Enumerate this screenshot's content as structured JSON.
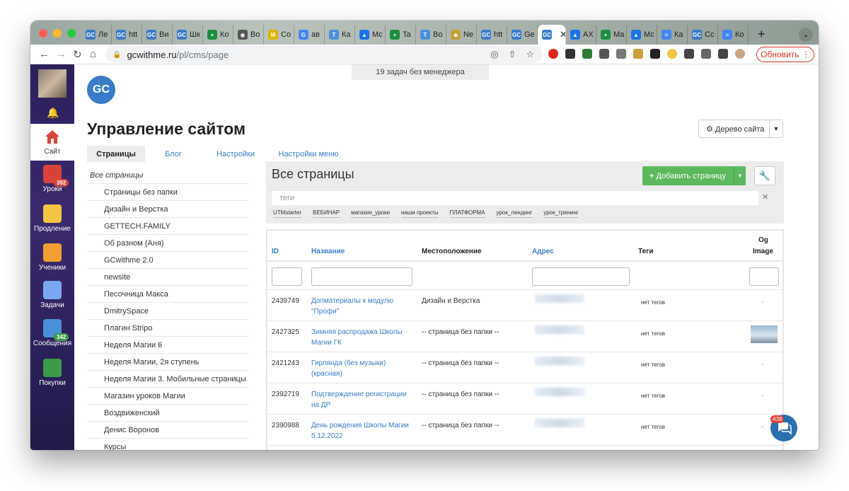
{
  "browser": {
    "tabs": [
      {
        "label": "Ле",
        "fav": "GC",
        "color": "#3a7bc8"
      },
      {
        "label": "htt",
        "fav": "GC",
        "color": "#3a7bc8"
      },
      {
        "label": "Ви",
        "fav": "GC",
        "color": "#3a7bc8"
      },
      {
        "label": "Шк",
        "fav": "GC",
        "color": "#3a7bc8"
      },
      {
        "label": "Ко",
        "fav": "+",
        "color": "#1e8e3e"
      },
      {
        "label": "Во",
        "fav": "◉",
        "color": "#555555"
      },
      {
        "label": "Со",
        "fav": "M",
        "color": "#e2b400"
      },
      {
        "label": "ав",
        "fav": "G",
        "color": "#4285f4"
      },
      {
        "label": "Ка",
        "fav": "T",
        "color": "#4a90d9"
      },
      {
        "label": "Мс",
        "fav": "▲",
        "color": "#1a73e8"
      },
      {
        "label": "Ta",
        "fav": "+",
        "color": "#1e8e3e"
      },
      {
        "label": "Во",
        "fav": "T",
        "color": "#4a90d9"
      },
      {
        "label": "Ne",
        "fav": "◆",
        "color": "#c8a03a"
      },
      {
        "label": "htt",
        "fav": "GC",
        "color": "#3a7bc8"
      },
      {
        "label": "Ge",
        "fav": "GC",
        "color": "#3a7bc8"
      },
      {
        "label": "",
        "fav": "GC",
        "color": "#3a7bc8",
        "active": true
      },
      {
        "label": "АХ",
        "fav": "▲",
        "color": "#1a73e8"
      },
      {
        "label": "Ма",
        "fav": "+",
        "color": "#1e8e3e"
      },
      {
        "label": "Мс",
        "fav": "▲",
        "color": "#1a73e8"
      },
      {
        "label": "Ка",
        "fav": "≡",
        "color": "#4285f4"
      },
      {
        "label": "Сс",
        "fav": "GC",
        "color": "#3a7bc8"
      },
      {
        "label": "Ко",
        "fav": "≡",
        "color": "#4285f4"
      }
    ],
    "url_domain": "gcwithme.ru",
    "url_path": "/pl/cms/page",
    "update_label": "Обновить"
  },
  "sidebar": {
    "site_label": "Сайт",
    "items": [
      {
        "label": "Уроки",
        "badge": "392",
        "badge_color": "#d9443a",
        "icon": "presentation-icon"
      },
      {
        "label": "Продление",
        "badge": "",
        "icon": "hourglass-icon"
      },
      {
        "label": "Ученики",
        "badge": "",
        "icon": "group-icon"
      },
      {
        "label": "Задачи",
        "badge": "",
        "icon": "checklist-icon"
      },
      {
        "label": "Сообщения",
        "badge": "342",
        "badge_color": "#3c9a4a",
        "icon": "chat-icon"
      },
      {
        "label": "Покупки",
        "badge": "",
        "icon": "calculator-icon"
      }
    ]
  },
  "header": {
    "notice": "19 задач без менеджера",
    "logo": "GC",
    "title": "Управление сайтом",
    "tree_button": "Дерево сайта"
  },
  "subtabs": [
    {
      "label": "Страницы",
      "active": true
    },
    {
      "label": "Блог"
    },
    {
      "label": "Настройки"
    },
    {
      "label": "Настройки меню"
    }
  ],
  "leftnav": [
    "Все страницы",
    "Страницы без папки",
    "Дизайн и Верстка",
    "GETTECH.FAMILY",
    "Об разном (Аня)",
    "GCwithme 2.0",
    "newsite",
    "Песочница Макса",
    "DmitrySpace",
    "Плагин Stripo",
    "Неделя Магии 6",
    "Неделя Магии, 2я ступень",
    "Неделя Магии 3. Мобильные страницы",
    "Магазин уроков Магии",
    "Воздвиженский",
    "Денис Воронов",
    "Курсы"
  ],
  "panel": {
    "title": "Все страницы",
    "add_button": "Добавить страницу",
    "tags_placeholder": "теги",
    "tags": [
      "UTMstarter",
      "ВЕБИНАР",
      "магазин_уроки",
      "наши проекты",
      "ПЛАТФОРМА",
      "урок_лендинг",
      "урок_тренинг"
    ]
  },
  "table": {
    "headers": {
      "id": "ID",
      "name": "Название",
      "location": "Местоположение",
      "address": "Адрес",
      "tags": "Теги",
      "og_line1": "Og",
      "og_line2": "Image"
    },
    "rows": [
      {
        "id": "2439749",
        "name": "Допматериалы к модулю \"Профи\"",
        "location": "Дизайн и Верстка",
        "tags": "нет тегов",
        "og": "-",
        "has_image": false
      },
      {
        "id": "2427325",
        "name": "Зимняя распродажа Школы Магии ГК",
        "location": "-- страница без папки --",
        "tags": "нет тегов",
        "og": "",
        "has_image": true
      },
      {
        "id": "2421243",
        "name": "Гирлянда (без музыки) (красная)",
        "location": "-- страница без папки --",
        "tags": "нет тегов",
        "og": "-",
        "has_image": false
      },
      {
        "id": "2392719",
        "name": "Подтверждение регистрации на ДР",
        "location": "-- страница без папки --",
        "tags": "нет тегов",
        "og": "-",
        "has_image": false
      },
      {
        "id": "2390988",
        "name": "День рождения Школы Магии 5.12.2022",
        "location": "-- страница без папки --",
        "tags": "нет тегов",
        "og": "-",
        "has_image": false
      }
    ]
  },
  "chat": {
    "badge": "438"
  }
}
